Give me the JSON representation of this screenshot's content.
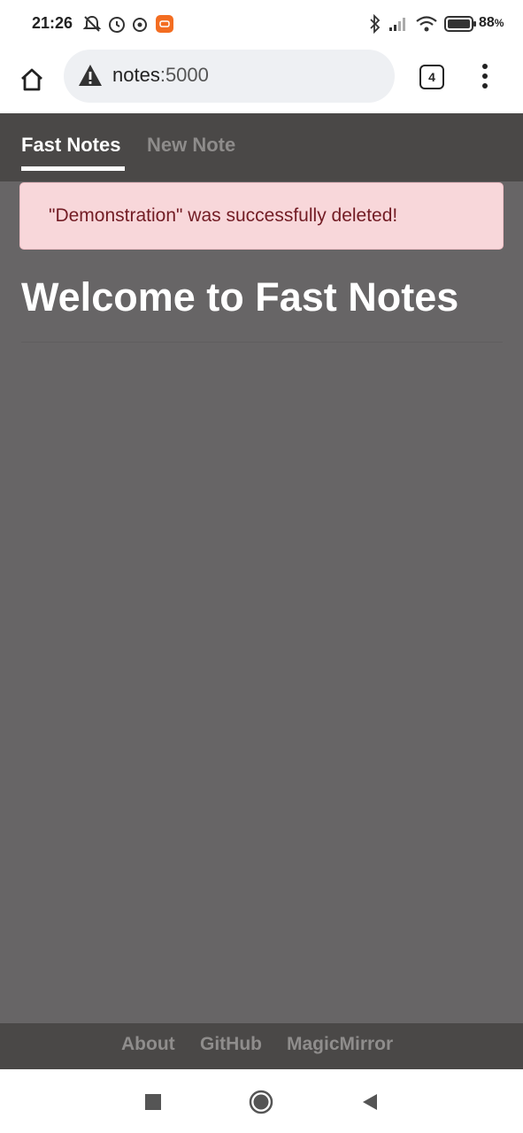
{
  "status_bar": {
    "time": "21:26",
    "battery_percent": "88",
    "battery_percent_symbol": "%",
    "icons": [
      "do-not-disturb-off-icon",
      "alarm-icon",
      "music-icon",
      "app-notification-icon",
      "bluetooth-icon",
      "cellular-signal-icon",
      "wifi-icon",
      "battery-icon"
    ]
  },
  "browser": {
    "url_host": "notes",
    "url_port": ":5000",
    "tab_count": "4",
    "icons": [
      "home-icon",
      "not-secure-warning-icon",
      "tabs-icon",
      "more-vert-icon"
    ]
  },
  "navbar": {
    "items": [
      {
        "label": "Fast Notes",
        "active": true
      },
      {
        "label": "New Note",
        "active": false
      }
    ]
  },
  "alert": {
    "message": "\"Demonstration\" was successfully deleted!",
    "colors": {
      "background": "#f8d7da",
      "text": "#721c24"
    }
  },
  "main": {
    "title": "Welcome to Fast Notes"
  },
  "footer": {
    "links": [
      {
        "label": "About"
      },
      {
        "label": "GitHub"
      },
      {
        "label": "MagicMirror"
      }
    ]
  },
  "android_nav": {
    "icons": [
      "recents-square-icon",
      "home-circle-icon",
      "back-triangle-icon"
    ]
  },
  "colors": {
    "page_background": "#676566",
    "navbar_background": "#4a4847",
    "active_nav": "#ffffff",
    "inactive_nav": "#8e8c8b"
  }
}
